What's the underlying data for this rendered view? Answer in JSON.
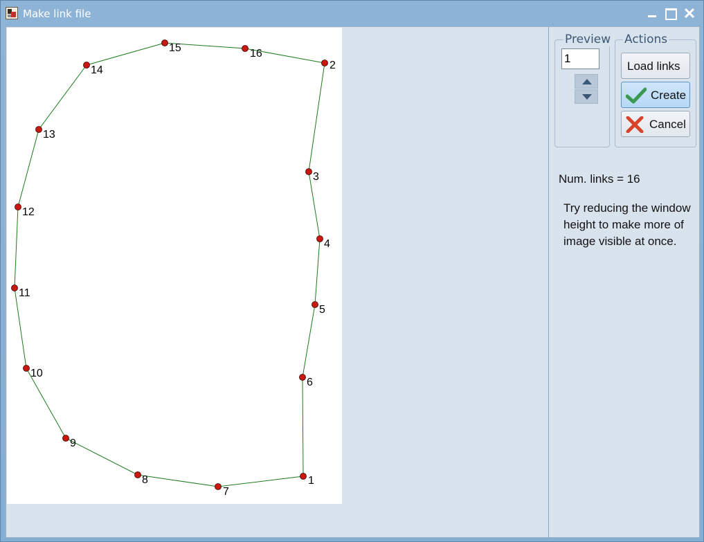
{
  "window": {
    "title": "Make link file",
    "icon": "app-icon",
    "controls": [
      "minimize-icon",
      "maximize-icon",
      "close-icon"
    ]
  },
  "preview": {
    "label": "Preview",
    "value": "1"
  },
  "actions": {
    "label": "Actions",
    "load_label": "Load links",
    "create_label": "Create",
    "cancel_label": "Cancel",
    "create_icon": "checkmark-icon",
    "cancel_icon": "cross-icon"
  },
  "info": {
    "num_links": "Num. links = 16",
    "hint": "Try reducing the window height to make more of image visible at once."
  },
  "nodes": [
    {
      "label": "1"
    },
    {
      "label": "2"
    },
    {
      "label": "3"
    },
    {
      "label": "4"
    },
    {
      "label": "5"
    },
    {
      "label": "6"
    },
    {
      "label": "7"
    },
    {
      "label": "8"
    },
    {
      "label": "9"
    },
    {
      "label": "10"
    },
    {
      "label": "11"
    },
    {
      "label": "12"
    },
    {
      "label": "13"
    },
    {
      "label": "14"
    },
    {
      "label": "15"
    },
    {
      "label": "16"
    }
  ],
  "link_order": [
    "1",
    "6",
    "5",
    "4",
    "3",
    "2",
    "16",
    "15",
    "14",
    "13",
    "12",
    "11",
    "10",
    "9",
    "8",
    "7",
    "1"
  ],
  "colors": {
    "link_line": "#1a7a1a",
    "node_fill": "#c8180f",
    "canvas_bg": "#ffffff",
    "panel_bg": "#d9e3ee",
    "titlebar": "#8db4d6"
  }
}
